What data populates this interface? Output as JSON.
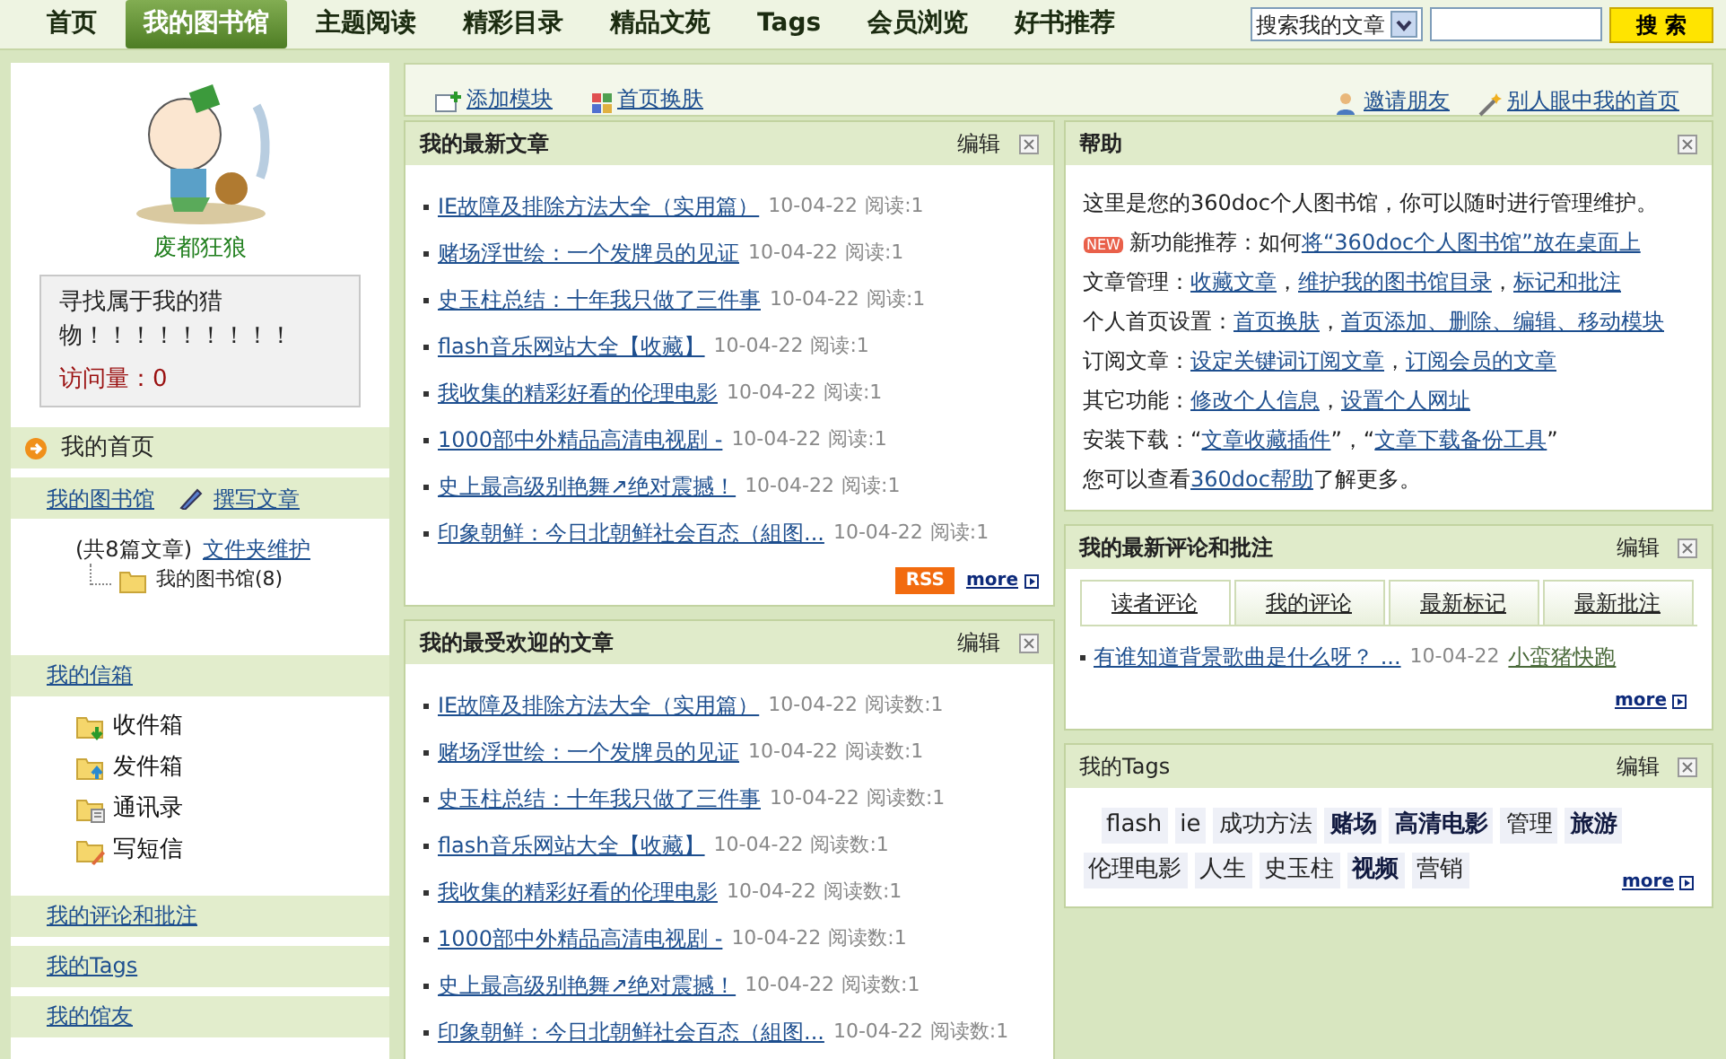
{
  "nav": {
    "items": [
      {
        "label": "首页",
        "selected": false
      },
      {
        "label": "我的图书馆",
        "selected": true
      },
      {
        "label": "主题阅读",
        "selected": false
      },
      {
        "label": "精彩目录",
        "selected": false
      },
      {
        "label": "精品文苑",
        "selected": false
      },
      {
        "label": "Tags",
        "selected": false
      },
      {
        "label": "会员浏览",
        "selected": false
      },
      {
        "label": "好书推荐",
        "selected": false
      }
    ],
    "search": {
      "scope": "搜索我的文章",
      "button": "搜 索"
    }
  },
  "profile": {
    "name": "废都狂狼",
    "motto": "寻找属于我的猎物！！！！！！！！！",
    "visits": "访问量：0"
  },
  "sidebar": [
    {
      "kind": "current",
      "label": "我的首页"
    },
    {
      "kind": "library",
      "label": "我的图书馆",
      "action": "撰写文章",
      "count": "(共8篇文章)",
      "manage": "文件夹维护",
      "folders": [
        "我的图书馆(8)"
      ]
    },
    {
      "kind": "mailbox",
      "label": "我的信箱",
      "items": [
        {
          "kind": "inbox",
          "label": "收件箱"
        },
        {
          "kind": "outbox",
          "label": "发件箱"
        },
        {
          "kind": "contacts",
          "label": "通讯录"
        },
        {
          "kind": "compose",
          "label": "写短信"
        }
      ]
    },
    {
      "kind": "link",
      "label": "我的评论和批注"
    },
    {
      "kind": "link",
      "label": "我的Tags"
    },
    {
      "kind": "link",
      "label": "我的馆友"
    }
  ],
  "toolbar": {
    "left": [
      {
        "kind": "add",
        "label": "添加模块"
      },
      {
        "kind": "skin",
        "label": "首页换肤"
      }
    ],
    "right": [
      {
        "kind": "invite",
        "label": "邀请朋友"
      },
      {
        "kind": "view",
        "label": "别人眼中我的首页"
      }
    ]
  },
  "middle_panels": [
    {
      "title": "我的最新文章",
      "edit": "编辑",
      "rss": "RSS",
      "more": "more",
      "items": [
        {
          "title": "IE故障及排除方法大全（实用篇）",
          "date": "10-04-22",
          "reads": "阅读:1"
        },
        {
          "title": "赌场浮世绘：一个发牌员的见证",
          "date": "10-04-22",
          "reads": "阅读:1"
        },
        {
          "title": "史玉柱总结：十年我只做了三件事",
          "date": "10-04-22",
          "reads": "阅读:1"
        },
        {
          "title": "flash音乐网站大全【收藏】",
          "date": "10-04-22",
          "reads": "阅读:1"
        },
        {
          "title": "我收集的精彩好看的伦理电影",
          "date": "10-04-22",
          "reads": "阅读:1"
        },
        {
          "title": "1000部中外精品高清电视剧 -",
          "date": "10-04-22",
          "reads": "阅读:1"
        },
        {
          "title": "史上最高级别艳舞↗绝对震撼！",
          "date": "10-04-22",
          "reads": "阅读:1"
        },
        {
          "title": "印象朝鲜：今日北朝鲜社会百态（組图...",
          "date": "10-04-22",
          "reads": "阅读:1"
        }
      ]
    },
    {
      "title": "我的最受欢迎的文章",
      "edit": "编辑",
      "items": [
        {
          "title": "IE故障及排除方法大全（实用篇）",
          "date": "10-04-22",
          "reads": "阅读数:1"
        },
        {
          "title": "赌场浮世绘：一个发牌员的见证",
          "date": "10-04-22",
          "reads": "阅读数:1"
        },
        {
          "title": "史玉柱总结：十年我只做了三件事",
          "date": "10-04-22",
          "reads": "阅读数:1"
        },
        {
          "title": "flash音乐网站大全【收藏】",
          "date": "10-04-22",
          "reads": "阅读数:1"
        },
        {
          "title": "我收集的精彩好看的伦理电影",
          "date": "10-04-22",
          "reads": "阅读数:1"
        },
        {
          "title": "1000部中外精品高清电视剧 -",
          "date": "10-04-22",
          "reads": "阅读数:1"
        },
        {
          "title": "史上最高级别艳舞↗绝对震撼！",
          "date": "10-04-22",
          "reads": "阅读数:1"
        },
        {
          "title": "印象朝鲜：今日北朝鲜社会百态（組图...",
          "date": "10-04-22",
          "reads": "阅读数:1"
        }
      ]
    }
  ],
  "help": {
    "title": "帮助",
    "lines": [
      [
        {
          "kind": "text",
          "text": "这里是您的360doc个人图书馆，你可以随时进行管理维护。"
        }
      ],
      [
        {
          "kind": "badge",
          "text": "NEW"
        },
        {
          "kind": "text",
          "text": "新功能推荐：如何"
        },
        {
          "kind": "link",
          "text": "将“360doc个人图书馆”放在桌面上"
        }
      ],
      [
        {
          "kind": "text",
          "text": "文章管理："
        },
        {
          "kind": "link",
          "text": "收藏文章",
          "after": "，"
        },
        {
          "kind": "link",
          "text": "维护我的图书馆目录",
          "after": "，"
        },
        {
          "kind": "link",
          "text": "标记和批注"
        }
      ],
      [
        {
          "kind": "text",
          "text": "个人首页设置："
        },
        {
          "kind": "link",
          "text": "首页换肤",
          "after": "，"
        },
        {
          "kind": "link",
          "text": "首页添加、删除、编辑、移动模块"
        }
      ],
      [
        {
          "kind": "text",
          "text": "订阅文章："
        },
        {
          "kind": "link",
          "text": "设定关键词订阅文章",
          "after": "，"
        },
        {
          "kind": "link",
          "text": "订阅会员的文章"
        }
      ],
      [
        {
          "kind": "text",
          "text": "其它功能："
        },
        {
          "kind": "link",
          "text": "修改个人信息",
          "after": "，"
        },
        {
          "kind": "link",
          "text": "设置个人网址"
        }
      ],
      [
        {
          "kind": "text",
          "text": "安装下载：“"
        },
        {
          "kind": "link",
          "text": "文章收藏插件",
          "after": "”，“"
        },
        {
          "kind": "link",
          "text": "文章下载备份工具",
          "after": "”"
        }
      ],
      [
        {
          "kind": "text",
          "text": "您可以查看"
        },
        {
          "kind": "link",
          "text": "360doc帮助",
          "after": "了解更多。"
        }
      ]
    ]
  },
  "comments": {
    "title": "我的最新评论和批注",
    "edit": "编辑",
    "tabs": [
      {
        "label": "读者评论",
        "selected": true
      },
      {
        "label": "我的评论",
        "selected": false
      },
      {
        "label": "最新标记",
        "selected": false
      },
      {
        "label": "最新批注",
        "selected": false
      }
    ],
    "items": [
      {
        "title": "有谁知道背景歌曲是什么呀？ ...",
        "date": "10-04-22",
        "author": "小蛮猪快跑"
      }
    ],
    "more": "more"
  },
  "tags": {
    "title": "我的Tags",
    "edit": "编辑",
    "more": "more",
    "items": [
      {
        "label": "flash",
        "kind": "normal"
      },
      {
        "label": "ie",
        "kind": "normal"
      },
      {
        "label": "成功方法",
        "kind": "normal"
      },
      {
        "label": "赌场",
        "kind": "hot"
      },
      {
        "label": "高清电影",
        "kind": "hot"
      },
      {
        "label": "管理",
        "kind": "normal"
      },
      {
        "label": "旅游",
        "kind": "hot"
      },
      {
        "label": "伦理电影",
        "kind": "normal"
      },
      {
        "label": "人生",
        "kind": "normal"
      },
      {
        "label": "史玉柱",
        "kind": "normal"
      },
      {
        "label": "视频",
        "kind": "hot"
      },
      {
        "label": "营销",
        "kind": "normal"
      }
    ]
  }
}
